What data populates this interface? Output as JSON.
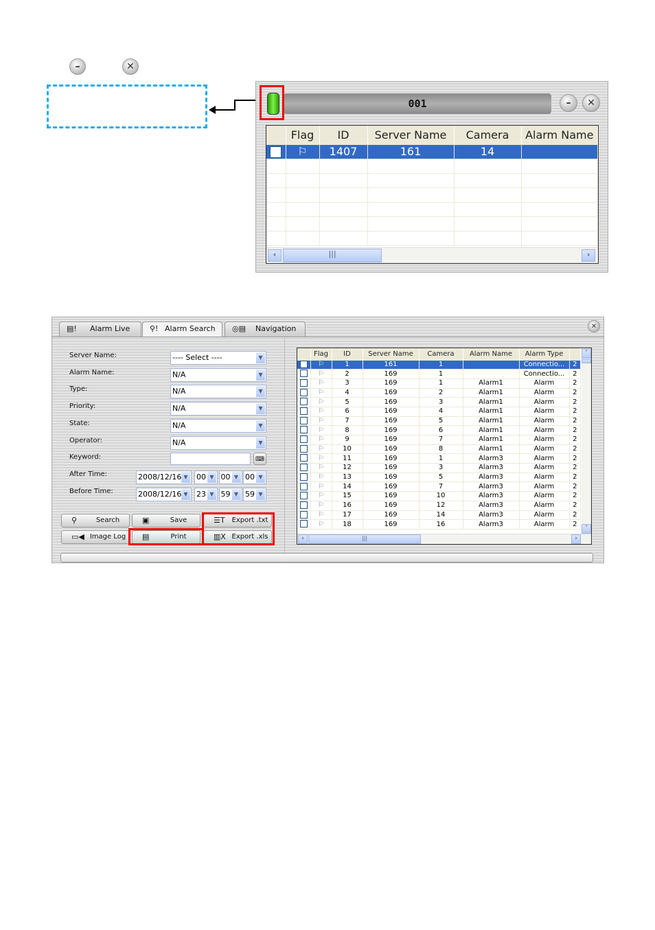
{
  "legend": {
    "minimize_icon": "minimize-icon",
    "close_icon": "close-icon"
  },
  "live": {
    "title": "001",
    "columns": [
      "",
      "Flag",
      "ID",
      "Server Name",
      "Camera",
      "Alarm Name"
    ],
    "rows": [
      {
        "id": "1407",
        "server": "161",
        "camera": "14",
        "alarm": ""
      }
    ],
    "empty_rows": 6,
    "status_color": "#3fcf10"
  },
  "search": {
    "tabs": [
      {
        "label": "Alarm Live",
        "icon": "alarm-live-icon"
      },
      {
        "label": "Alarm Search",
        "icon": "alarm-search-icon"
      },
      {
        "label": "Navigation",
        "icon": "navigation-icon"
      }
    ],
    "fields": {
      "server_name": {
        "label": "Server Name:",
        "value": "----  Select  ----"
      },
      "alarm_name": {
        "label": "Alarm Name:",
        "value": "N/A"
      },
      "type": {
        "label": "Type:",
        "value": "N/A"
      },
      "priority": {
        "label": "Priority:",
        "value": "N/A"
      },
      "state": {
        "label": "State:",
        "value": "N/A"
      },
      "operator": {
        "label": "Operator:",
        "value": "N/A"
      },
      "keyword": {
        "label": "Keyword:",
        "value": ""
      },
      "after": {
        "label": "After Time:",
        "date": "2008/12/16",
        "h": "00",
        "m": "00",
        "s": "00"
      },
      "before": {
        "label": "Before Time:",
        "date": "2008/12/16",
        "h": "23",
        "m": "59",
        "s": "59"
      }
    },
    "buttons": {
      "search": "Search",
      "save": "Save",
      "export_txt": "Export .txt",
      "image_log": "Image Log",
      "print": "Print",
      "export_xls": "Export .xls"
    },
    "columns": [
      "",
      "Flag",
      "ID",
      "Server Name",
      "Camera",
      "Alarm Name",
      "Alarm Type",
      ""
    ],
    "rows": [
      [
        "1",
        "161",
        "1",
        "",
        "Connectio...",
        "2"
      ],
      [
        "2",
        "169",
        "1",
        "",
        "Connectio...",
        "2"
      ],
      [
        "3",
        "169",
        "1",
        "Alarm1",
        "Alarm",
        "2"
      ],
      [
        "4",
        "169",
        "2",
        "Alarm1",
        "Alarm",
        "2"
      ],
      [
        "5",
        "169",
        "3",
        "Alarm1",
        "Alarm",
        "2"
      ],
      [
        "6",
        "169",
        "4",
        "Alarm1",
        "Alarm",
        "2"
      ],
      [
        "7",
        "169",
        "5",
        "Alarm1",
        "Alarm",
        "2"
      ],
      [
        "8",
        "169",
        "6",
        "Alarm1",
        "Alarm",
        "2"
      ],
      [
        "9",
        "169",
        "7",
        "Alarm1",
        "Alarm",
        "2"
      ],
      [
        "10",
        "169",
        "8",
        "Alarm1",
        "Alarm",
        "2"
      ],
      [
        "11",
        "169",
        "1",
        "Alarm3",
        "Alarm",
        "2"
      ],
      [
        "12",
        "169",
        "3",
        "Alarm3",
        "Alarm",
        "2"
      ],
      [
        "13",
        "169",
        "5",
        "Alarm3",
        "Alarm",
        "2"
      ],
      [
        "14",
        "169",
        "7",
        "Alarm3",
        "Alarm",
        "2"
      ],
      [
        "15",
        "169",
        "10",
        "Alarm3",
        "Alarm",
        "2"
      ],
      [
        "16",
        "169",
        "12",
        "Alarm3",
        "Alarm",
        "2"
      ],
      [
        "17",
        "169",
        "14",
        "Alarm3",
        "Alarm",
        "2"
      ],
      [
        "18",
        "169",
        "16",
        "Alarm3",
        "Alarm",
        "2"
      ]
    ]
  },
  "highlight_color": "#e00000",
  "dashed_color": "#1aaee8"
}
